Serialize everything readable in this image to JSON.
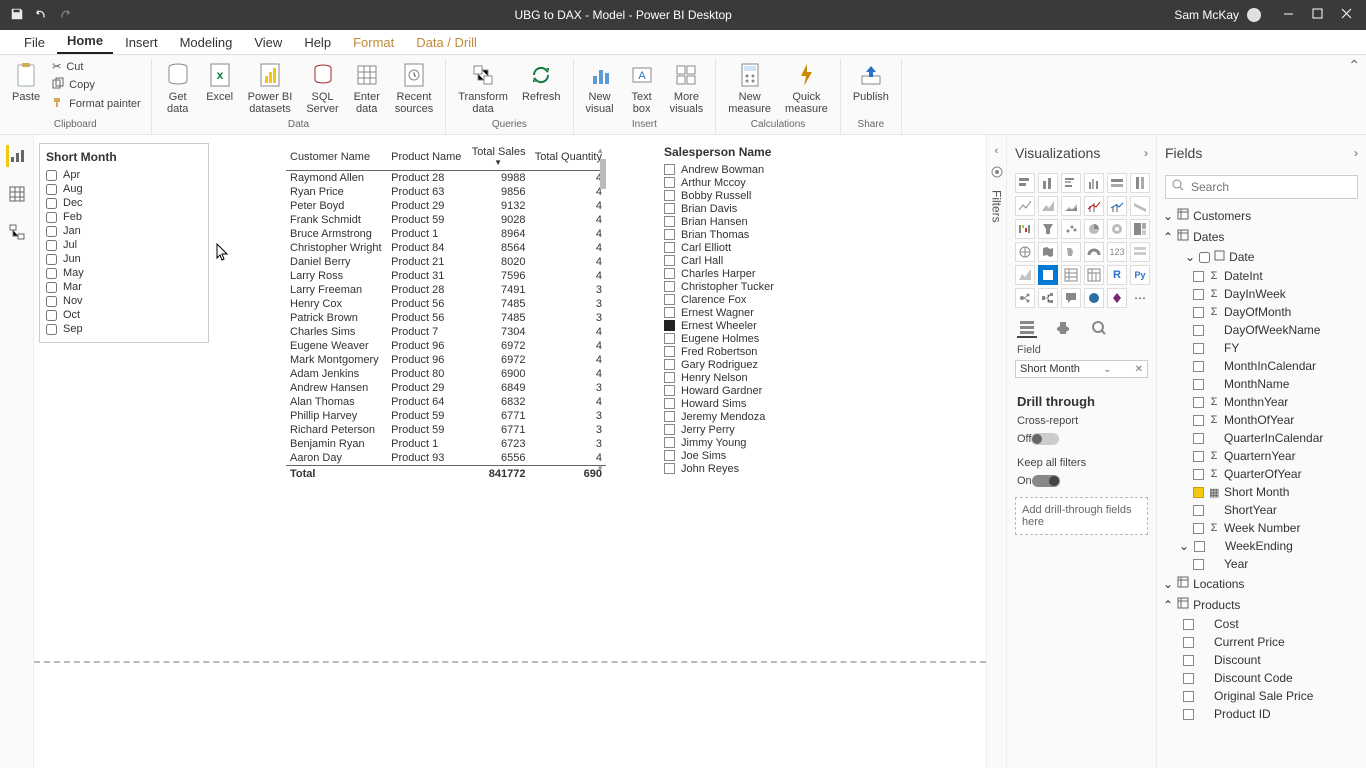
{
  "app": {
    "title": "UBG to DAX - Model - Power BI Desktop",
    "user": "Sam McKay"
  },
  "menu": {
    "tabs": [
      "File",
      "Home",
      "Insert",
      "Modeling",
      "View",
      "Help",
      "Format",
      "Data / Drill"
    ],
    "active": "Home"
  },
  "ribbon": {
    "clipboard": {
      "label": "Clipboard",
      "paste": "Paste",
      "cut": "Cut",
      "copy": "Copy",
      "format_painter": "Format painter"
    },
    "data": {
      "label": "Data",
      "get_data": "Get\ndata",
      "excel": "Excel",
      "pbi_ds": "Power BI\ndatasets",
      "sql": "SQL\nServer",
      "enter": "Enter\ndata",
      "recent": "Recent\nsources"
    },
    "queries": {
      "label": "Queries",
      "transform": "Transform\ndata",
      "refresh": "Refresh"
    },
    "insert": {
      "label": "Insert",
      "new_visual": "New\nvisual",
      "text_box": "Text\nbox",
      "more": "More\nvisuals"
    },
    "calc": {
      "label": "Calculations",
      "new_measure": "New\nmeasure",
      "quick": "Quick\nmeasure"
    },
    "share": {
      "label": "Share",
      "publish": "Publish"
    }
  },
  "canvas": {
    "months_header": "Short Month",
    "months": [
      "Apr",
      "Aug",
      "Dec",
      "Feb",
      "Jan",
      "Jul",
      "Jun",
      "May",
      "Mar",
      "Nov",
      "Oct",
      "Sep"
    ],
    "table": {
      "headers": [
        "Customer Name",
        "Product Name",
        "Total Sales",
        "Total Quantity"
      ],
      "rows": [
        [
          "Raymond Allen",
          "Product 28",
          "9988",
          "4"
        ],
        [
          "Ryan Price",
          "Product 63",
          "9856",
          "4"
        ],
        [
          "Peter Boyd",
          "Product 29",
          "9132",
          "4"
        ],
        [
          "Frank Schmidt",
          "Product 59",
          "9028",
          "4"
        ],
        [
          "Bruce Armstrong",
          "Product 1",
          "8964",
          "4"
        ],
        [
          "Christopher Wright",
          "Product 84",
          "8564",
          "4"
        ],
        [
          "Daniel Berry",
          "Product 21",
          "8020",
          "4"
        ],
        [
          "Larry Ross",
          "Product 31",
          "7596",
          "4"
        ],
        [
          "Larry Freeman",
          "Product 28",
          "7491",
          "3"
        ],
        [
          "Henry Cox",
          "Product 56",
          "7485",
          "3"
        ],
        [
          "Patrick Brown",
          "Product 56",
          "7485",
          "3"
        ],
        [
          "Charles Sims",
          "Product 7",
          "7304",
          "4"
        ],
        [
          "Eugene Weaver",
          "Product 96",
          "6972",
          "4"
        ],
        [
          "Mark Montgomery",
          "Product 96",
          "6972",
          "4"
        ],
        [
          "Adam Jenkins",
          "Product 80",
          "6900",
          "4"
        ],
        [
          "Andrew Hansen",
          "Product 29",
          "6849",
          "3"
        ],
        [
          "Alan Thomas",
          "Product 64",
          "6832",
          "4"
        ],
        [
          "Phillip Harvey",
          "Product 59",
          "6771",
          "3"
        ],
        [
          "Richard Peterson",
          "Product 59",
          "6771",
          "3"
        ],
        [
          "Benjamin Ryan",
          "Product 1",
          "6723",
          "3"
        ],
        [
          "Aaron Day",
          "Product 93",
          "6556",
          "4"
        ]
      ],
      "total_label": "Total",
      "total_sales": "841772",
      "total_qty": "690"
    },
    "sales_header": "Salesperson Name",
    "salespeople": [
      "Andrew Bowman",
      "Arthur Mccoy",
      "Bobby Russell",
      "Brian Davis",
      "Brian Hansen",
      "Brian Thomas",
      "Carl Elliott",
      "Carl Hall",
      "Charles Harper",
      "Christopher Tucker",
      "Clarence Fox",
      "Ernest Wagner",
      "Ernest Wheeler",
      "Eugene Holmes",
      "Fred Robertson",
      "Gary Rodriguez",
      "Henry Nelson",
      "Howard Gardner",
      "Howard Sims",
      "Jeremy Mendoza",
      "Jerry Perry",
      "Jimmy Young",
      "Joe Sims",
      "John Reyes"
    ],
    "selected_salesperson_index": 12
  },
  "filters_label": "Filters",
  "viz": {
    "header": "Visualizations",
    "field_label": "Field",
    "field_value": "Short Month",
    "drill_header": "Drill through",
    "cross_report": "Cross-report",
    "off": "Off",
    "keep_all": "Keep all filters",
    "on": "On",
    "drop_hint": "Add drill-through fields here"
  },
  "fields": {
    "header": "Fields",
    "search_ph": "Search",
    "tables": {
      "customers": "Customers",
      "dates": "Dates",
      "locations": "Locations",
      "products": "Products"
    },
    "dates_sub": "Date",
    "date_fields": [
      {
        "name": "DateInt",
        "sigma": true
      },
      {
        "name": "DayInWeek",
        "sigma": true
      },
      {
        "name": "DayOfMonth",
        "sigma": true
      },
      {
        "name": "DayOfWeekName",
        "sigma": false
      },
      {
        "name": "FY",
        "sigma": false
      },
      {
        "name": "MonthInCalendar",
        "sigma": false
      },
      {
        "name": "MonthName",
        "sigma": false
      },
      {
        "name": "MonthnYear",
        "sigma": true
      },
      {
        "name": "MonthOfYear",
        "sigma": true
      },
      {
        "name": "QuarterInCalendar",
        "sigma": false
      },
      {
        "name": "QuarternYear",
        "sigma": true
      },
      {
        "name": "QuarterOfYear",
        "sigma": true
      },
      {
        "name": "Short Month",
        "sigma": false,
        "checked": true,
        "table_icon": true
      },
      {
        "name": "ShortYear",
        "sigma": false
      },
      {
        "name": "Week Number",
        "sigma": true
      },
      {
        "name": "WeekEnding",
        "sigma": false,
        "expandable": true
      },
      {
        "name": "Year",
        "sigma": false
      }
    ],
    "product_fields": [
      {
        "name": "Cost"
      },
      {
        "name": "Current Price"
      },
      {
        "name": "Discount"
      },
      {
        "name": "Discount Code"
      },
      {
        "name": "Original Sale Price"
      },
      {
        "name": "Product ID"
      }
    ]
  }
}
